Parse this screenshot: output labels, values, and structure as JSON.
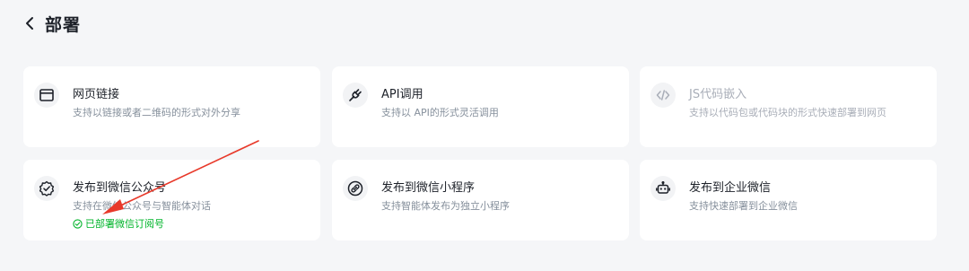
{
  "header": {
    "title": "部署",
    "back_icon": "chevron-left-icon"
  },
  "cards": [
    {
      "id": "web-link",
      "icon": "browser-window-icon",
      "title": "网页链接",
      "desc": "支持以链接或者二维码的形式对外分享",
      "disabled": false
    },
    {
      "id": "api",
      "icon": "plug-icon",
      "title": "API调用",
      "desc": "支持以 API的形式灵活调用",
      "disabled": false
    },
    {
      "id": "js-embed",
      "icon": "code-icon",
      "title": "JS代码嵌入",
      "desc": "支持以代码包或代码块的形式快速部署到网页",
      "disabled": true
    },
    {
      "id": "wechat-official",
      "icon": "badge-check-icon",
      "title": "发布到微信公众号",
      "desc": "支持在微信公众号与智能体对话",
      "status": "已部署微信订阅号",
      "disabled": false
    },
    {
      "id": "wechat-mini",
      "icon": "link-circle-icon",
      "title": "发布到微信小程序",
      "desc": "支持智能体发布为独立小程序",
      "disabled": false
    },
    {
      "id": "wecom",
      "icon": "robot-icon",
      "title": "发布到企业微信",
      "desc": "支持快速部署到企业微信",
      "disabled": false
    }
  ],
  "colors": {
    "success": "#00b42a",
    "annotation_arrow": "#e8392a",
    "background": "#f5f6f8",
    "card": "#ffffff"
  }
}
